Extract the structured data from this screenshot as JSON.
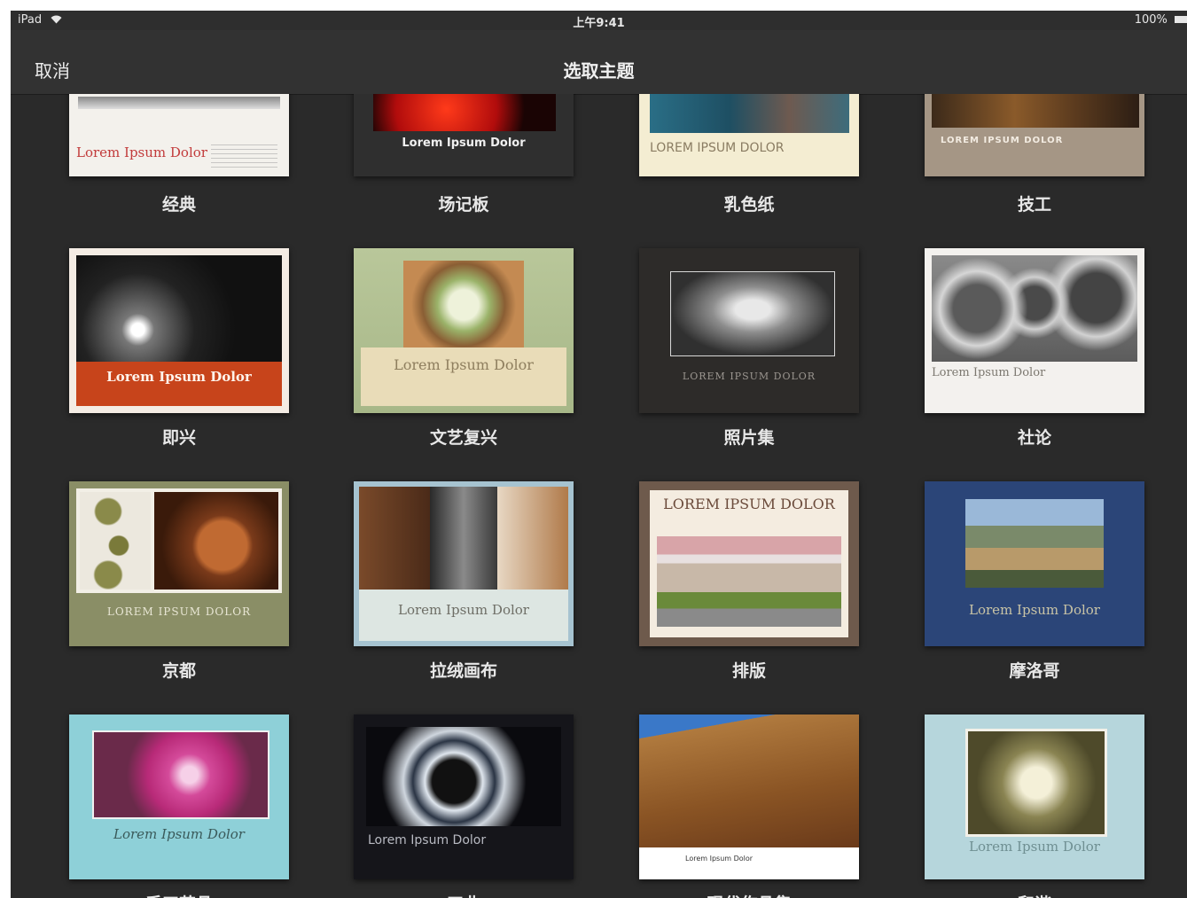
{
  "status": {
    "device": "iPad",
    "time": "上午9:41",
    "battery": "100%"
  },
  "nav": {
    "cancel": "取消",
    "title": "选取主题"
  },
  "themes": [
    {
      "name": "经典",
      "caption": "Lorem Ipsum Dolor"
    },
    {
      "name": "场记板",
      "caption": "Lorem Ipsum Dolor"
    },
    {
      "name": "乳色纸",
      "caption": "LOREM IPSUM DOLOR"
    },
    {
      "name": "技工",
      "caption": "LOREM IPSUM DOLOR"
    },
    {
      "name": "即兴",
      "caption": "Lorem Ipsum Dolor"
    },
    {
      "name": "文艺复兴",
      "caption": "Lorem Ipsum Dolor"
    },
    {
      "name": "照片集",
      "caption": "LOREM IPSUM DOLOR"
    },
    {
      "name": "社论",
      "caption": "Lorem Ipsum Dolor"
    },
    {
      "name": "京都",
      "caption": "LOREM IPSUM DOLOR"
    },
    {
      "name": "拉绒画布",
      "caption": "Lorem Ipsum Dolor"
    },
    {
      "name": "排版",
      "caption": "LOREM IPSUM DOLOR"
    },
    {
      "name": "摩洛哥",
      "caption": "Lorem Ipsum Dolor"
    },
    {
      "name": "手工艺品",
      "caption": "Lorem Ipsum Dolor"
    },
    {
      "name": "工业",
      "caption": "Lorem Ipsum Dolor"
    },
    {
      "name": "现代作品集",
      "caption": "Lorem Ipsum Dolor"
    },
    {
      "name": "和谐",
      "caption": "Lorem Ipsum Dolor"
    }
  ]
}
